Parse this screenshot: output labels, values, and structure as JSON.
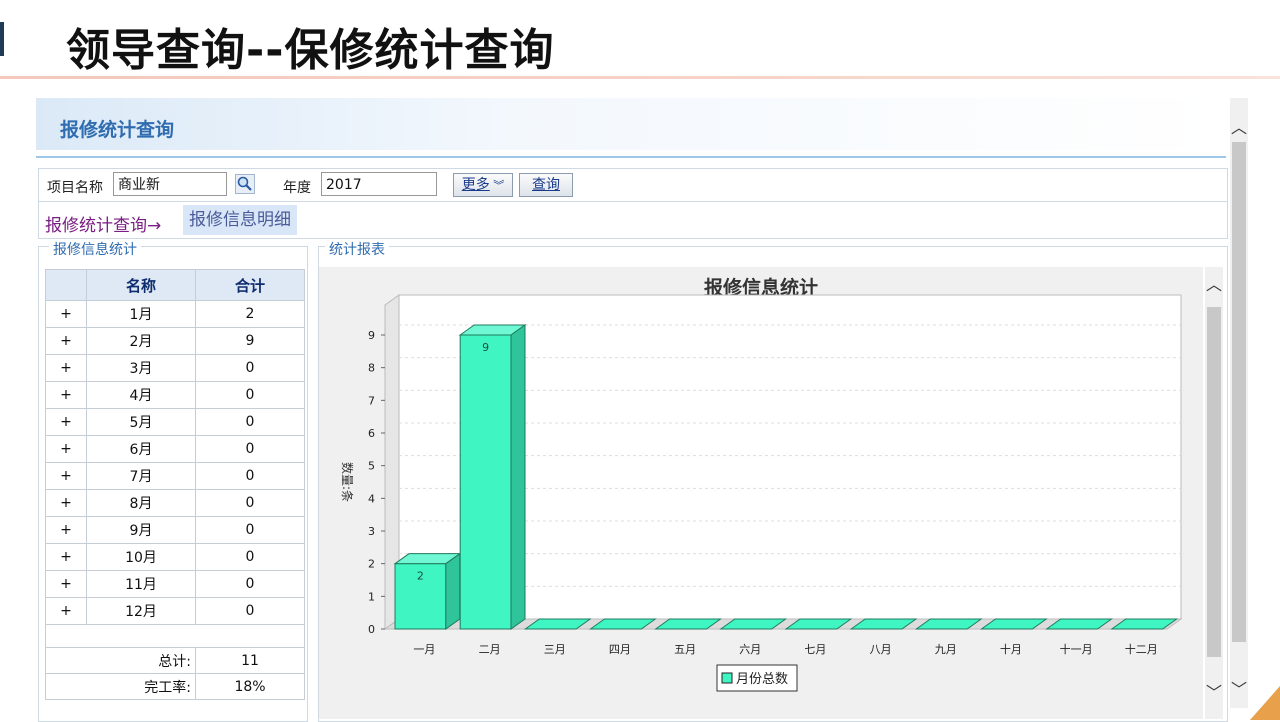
{
  "slide": {
    "title": "领导查询--保修统计查询"
  },
  "header": {
    "title": "报修统计查询"
  },
  "filter": {
    "project_label": "项目名称",
    "project_value": "商业新",
    "year_label": "年度",
    "year_value": "2017",
    "more_label": "更多",
    "query_label": "查询"
  },
  "breadcrumb": {
    "item1": "报修统计查询→",
    "item2": "报修信息明细"
  },
  "left_panel": {
    "legend": "报修信息统计",
    "headers": [
      "名称",
      "合计"
    ],
    "rows": [
      {
        "exp": "+",
        "name": "1月",
        "total": "2"
      },
      {
        "exp": "+",
        "name": "2月",
        "total": "9"
      },
      {
        "exp": "+",
        "name": "3月",
        "total": "0"
      },
      {
        "exp": "+",
        "name": "4月",
        "total": "0"
      },
      {
        "exp": "+",
        "name": "5月",
        "total": "0"
      },
      {
        "exp": "+",
        "name": "6月",
        "total": "0"
      },
      {
        "exp": "+",
        "name": "7月",
        "total": "0"
      },
      {
        "exp": "+",
        "name": "8月",
        "total": "0"
      },
      {
        "exp": "+",
        "name": "9月",
        "total": "0"
      },
      {
        "exp": "+",
        "name": "10月",
        "total": "0"
      },
      {
        "exp": "+",
        "name": "11月",
        "total": "0"
      },
      {
        "exp": "+",
        "name": "12月",
        "total": "0"
      }
    ],
    "total_label": "总计:",
    "total_value": "11",
    "rate_label": "完工率:",
    "rate_value": "18%"
  },
  "right_panel": {
    "legend": "统计报表"
  },
  "chart_data": {
    "type": "bar",
    "title": "报修信息统计",
    "ylabel": "数量:条",
    "xlabel": "",
    "categories": [
      "一月",
      "二月",
      "三月",
      "四月",
      "五月",
      "六月",
      "七月",
      "八月",
      "九月",
      "十月",
      "十一月",
      "十二月"
    ],
    "series": [
      {
        "name": "月份总数",
        "values": [
          2,
          9,
          0,
          0,
          0,
          0,
          0,
          0,
          0,
          0,
          0,
          0
        ]
      }
    ],
    "ylim": [
      0,
      9
    ],
    "yticks": [
      0,
      1,
      2,
      3,
      4,
      5,
      6,
      7,
      8,
      9
    ],
    "grid": true,
    "legend": "bottom",
    "bar_color": "#3ff5c2"
  },
  "icons": {
    "search": "search-icon",
    "more": "chevron-double-down-icon",
    "up": "chevron-up-icon",
    "down": "chevron-down-icon"
  }
}
